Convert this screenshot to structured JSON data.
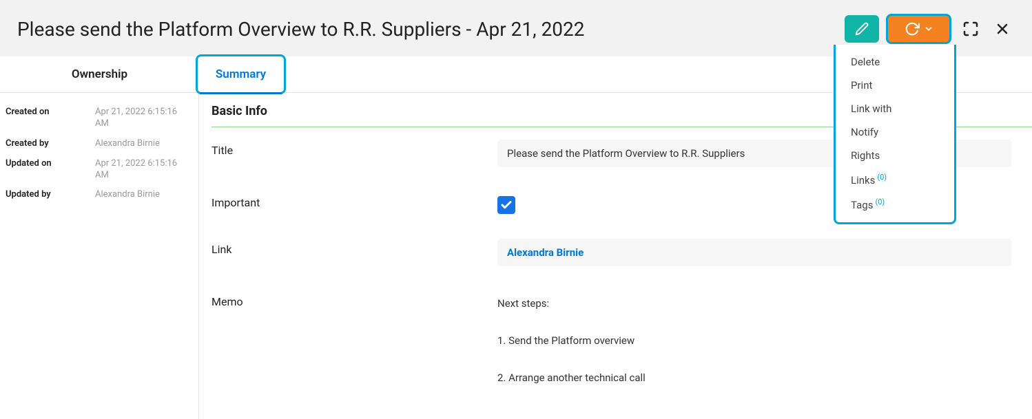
{
  "header": {
    "title": "Please send the Platform Overview to R.R. Suppliers - Apr 21, 2022"
  },
  "tabs": {
    "ownership": "Ownership",
    "summary": "Summary"
  },
  "sidebar": {
    "created_on_label": "Created on",
    "created_on_value": "Apr 21, 2022 6:15:16 AM",
    "created_by_label": "Created by",
    "created_by_value": "Alexandra Birnie",
    "updated_on_label": "Updated on",
    "updated_on_value": "Apr 21, 2022 6:15:16 AM",
    "updated_by_label": "Updated by",
    "updated_by_value": "Alexandra Birnie"
  },
  "main": {
    "section_title": "Basic Info",
    "title_label": "Title",
    "title_value": "Please send the Platform Overview to R.R. Suppliers",
    "important_label": "Important",
    "link_label": "Link",
    "link_value": "Alexandra Birnie",
    "memo_label": "Memo",
    "memo_line1": "Next steps:",
    "memo_line2": "1. Send the Platform overview",
    "memo_line3": "2. Arrange another technical call"
  },
  "dropdown": {
    "delete": "Delete",
    "print": "Print",
    "link_with": "Link with",
    "notify": "Notify",
    "rights": "Rights",
    "links": "Links",
    "links_count": "(0)",
    "tags": "Tags",
    "tags_count": "(0)"
  }
}
